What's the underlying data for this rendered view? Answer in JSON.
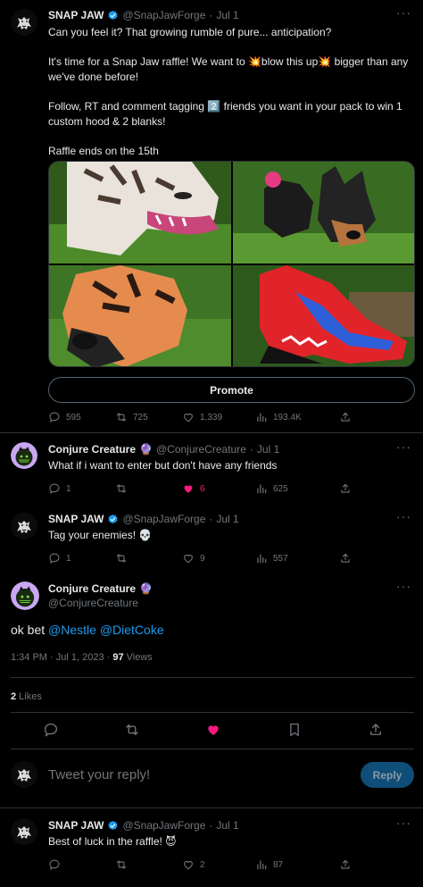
{
  "tweet": {
    "author_name": "SNAP JAW",
    "author_handle": "@SnapJawForge",
    "date": "Jul 1",
    "body_lines": [
      "Can you feel it? That growing rumble of pure... anticipation?",
      "It's time for a Snap Jaw raffle! We want to ",
      "blow this up",
      " bigger than any we've done before!",
      "Follow, RT and comment tagging ",
      " friends you want in your pack to win 1 custom hood & 2 blanks!",
      "Raffle ends on the 15th"
    ],
    "emoji": {
      "explosion": "💥",
      "keycap_two": "2️⃣"
    },
    "promote_label": "Promote",
    "stats": {
      "replies": "595",
      "retweets": "725",
      "likes": "1,339",
      "views": "193.4K"
    }
  },
  "reply1": {
    "author_name": "Conjure Creature",
    "badge": "🔮",
    "author_handle": "@ConjureCreature",
    "date": "Jul 1",
    "text": "What if i want to enter but don't have any friends",
    "stats": {
      "replies": "1",
      "retweets": "",
      "likes": "6",
      "views": "625"
    }
  },
  "reply2": {
    "author_name": "SNAP JAW",
    "author_handle": "@SnapJawForge",
    "date": "Jul 1",
    "text": "Tag your enemies! 💀",
    "stats": {
      "replies": "1",
      "retweets": "",
      "likes": "9",
      "views": "557"
    }
  },
  "focused": {
    "author_name": "Conjure Creature",
    "badge": "🔮",
    "author_handle": "@ConjureCreature",
    "text_prefix": "ok bet ",
    "mention1": "@Nestle",
    "mention2": "@DietCoke",
    "timestamp": "1:34 PM · Jul 1, 2023 · ",
    "views_count": "97",
    "views_label": " Views",
    "likes_count": "2",
    "likes_label": " Likes"
  },
  "compose": {
    "placeholder": "Tweet your reply!",
    "reply_label": "Reply"
  },
  "reply3": {
    "author_name": "SNAP JAW",
    "author_handle": "@SnapJawForge",
    "date": "Jul 1",
    "text": "Best of luck in the raffle! 😈",
    "stats": {
      "replies": "",
      "retweets": "",
      "likes": "2",
      "views": "87"
    }
  },
  "colors": {
    "accent": "#1d9bf0",
    "like": "#f91880",
    "muted": "#71767b"
  },
  "separator": "·",
  "icons": [
    "comment-icon",
    "retweet-icon",
    "heart-icon",
    "views-icon",
    "share-icon",
    "bookmark-icon",
    "verified-icon",
    "more-icon"
  ]
}
